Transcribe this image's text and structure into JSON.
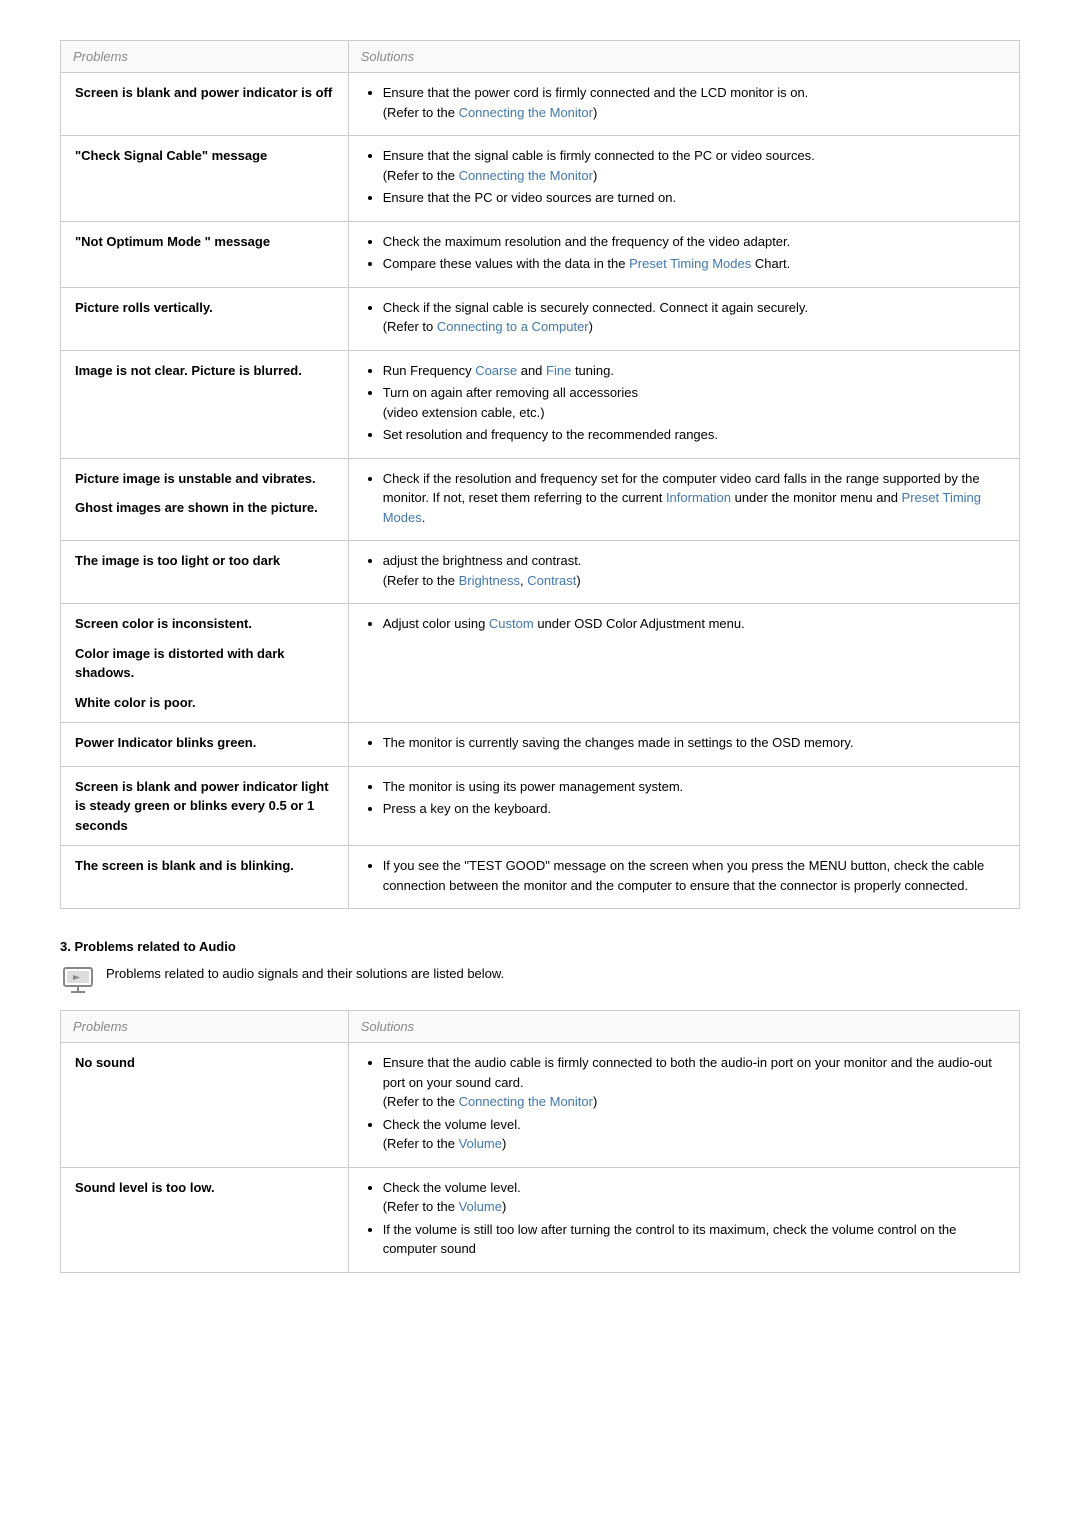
{
  "table1": {
    "col1_header": "Problems",
    "col2_header": "Solutions",
    "rows": [
      {
        "problem": "Screen is blank and power indicator is off",
        "solution_html": "<ul class='sol-list'><li>Ensure that the power cord is firmly connected and the LCD monitor is on.<br>(Refer to the <a class='link' href='#'>Connecting the Monitor</a>)</li></ul>"
      },
      {
        "problem": "\"Check Signal Cable\" message",
        "solution_html": "<ul class='sol-list'><li>Ensure that the signal cable is firmly connected to the PC or video sources.<br>(Refer to the <a class='link' href='#'>Connecting the Monitor</a>)</li><li>Ensure that the PC or video sources are turned on.</li></ul>"
      },
      {
        "problem": "\"Not Optimum Mode \" message",
        "solution_html": "<ul class='sol-list'><li>Check the maximum resolution and the frequency of the video adapter.</li><li>Compare these values with the data in the <a class='link' href='#'>Preset Timing Modes</a> Chart.</li></ul>"
      },
      {
        "problem": "Picture rolls vertically.",
        "solution_html": "<ul class='sol-list'><li>Check if the signal cable is securely connected. Connect it again securely.<br>(Refer to <a class='link' href='#'>Connecting to a Computer</a>)</li></ul>"
      },
      {
        "problem": "Image is not clear. Picture is blurred.",
        "solution_html": "<ul class='sol-list'><li>Run Frequency <a class='link' href='#'>Coarse</a> and <a class='link' href='#'>Fine</a> tuning.</li><li>Turn on again after removing all accessories<br>(video extension cable, etc.)</li><li>Set resolution and frequency to the recommended ranges.</li></ul>"
      },
      {
        "problem": "Picture image is unstable and vibrates.\n\nGhost images are shown in the picture.",
        "solution_html": "<ul class='sol-list'><li>Check if the resolution and frequency set for the computer video card falls in the range supported by the monitor. If not, reset them referring to the current <a class='link' href='#'>Information</a> under the monitor menu and <a class='link' href='#'>Preset Timing Modes</a>.</li></ul>"
      },
      {
        "problem": "The image is too light or too dark",
        "solution_html": "<ul class='sol-list'><li>adjust the brightness and contrast.<br>(Refer to the <a class='link' href='#'>Brightness</a>, <a class='link' href='#'>Contrast</a>)</li></ul>"
      },
      {
        "problem": "Screen color is inconsistent.\n\nColor image is distorted with dark shadows.\n\nWhite color is poor.",
        "solution_html": "<ul class='sol-list'><li>Adjust color using <a class='link' href='#'>Custom</a> under OSD Color Adjustment menu.</li></ul>"
      },
      {
        "problem": "Power Indicator blinks green.",
        "solution_html": "<ul class='sol-list'><li>The monitor is currently saving the changes made in settings to the OSD memory.</li></ul>"
      },
      {
        "problem": "Screen is blank and power indicator light is steady green or blinks every 0.5 or 1 seconds",
        "solution_html": "<ul class='sol-list'><li>The monitor is using its power management system.</li><li>Press a key on the keyboard.</li></ul>"
      },
      {
        "problem": "The screen is blank and is blinking.",
        "solution_html": "<ul class='sol-list'><li>If you see the \"TEST GOOD\" message on the screen when you press the MENU button, check the cable connection between the monitor and the computer to ensure that the connector is properly connected.</li></ul>"
      }
    ]
  },
  "section2": {
    "title": "3. Problems related to Audio",
    "note": "Problems related to audio signals and their solutions are listed below."
  },
  "table2": {
    "col1_header": "Problems",
    "col2_header": "Solutions",
    "rows": [
      {
        "problem": "No sound",
        "solution_html": "<ul class='sol-list'><li>Ensure that the audio cable is firmly connected to both the audio-in port on your monitor and the audio-out port on your sound card.<br>(Refer to the <a class='link' href='#'>Connecting the Monitor</a>)</li><li>Check the volume level.<br>(Refer to the <a class='link' href='#'>Volume</a>)</li></ul>"
      },
      {
        "problem": "Sound level is too low.",
        "solution_html": "<ul class='sol-list'><li>Check the volume level.<br>(Refer to the <a class='link' href='#'>Volume</a>)</li><li>If the volume is still too low after turning the control to its maximum, check the volume control on the computer sound</li></ul>"
      }
    ]
  }
}
